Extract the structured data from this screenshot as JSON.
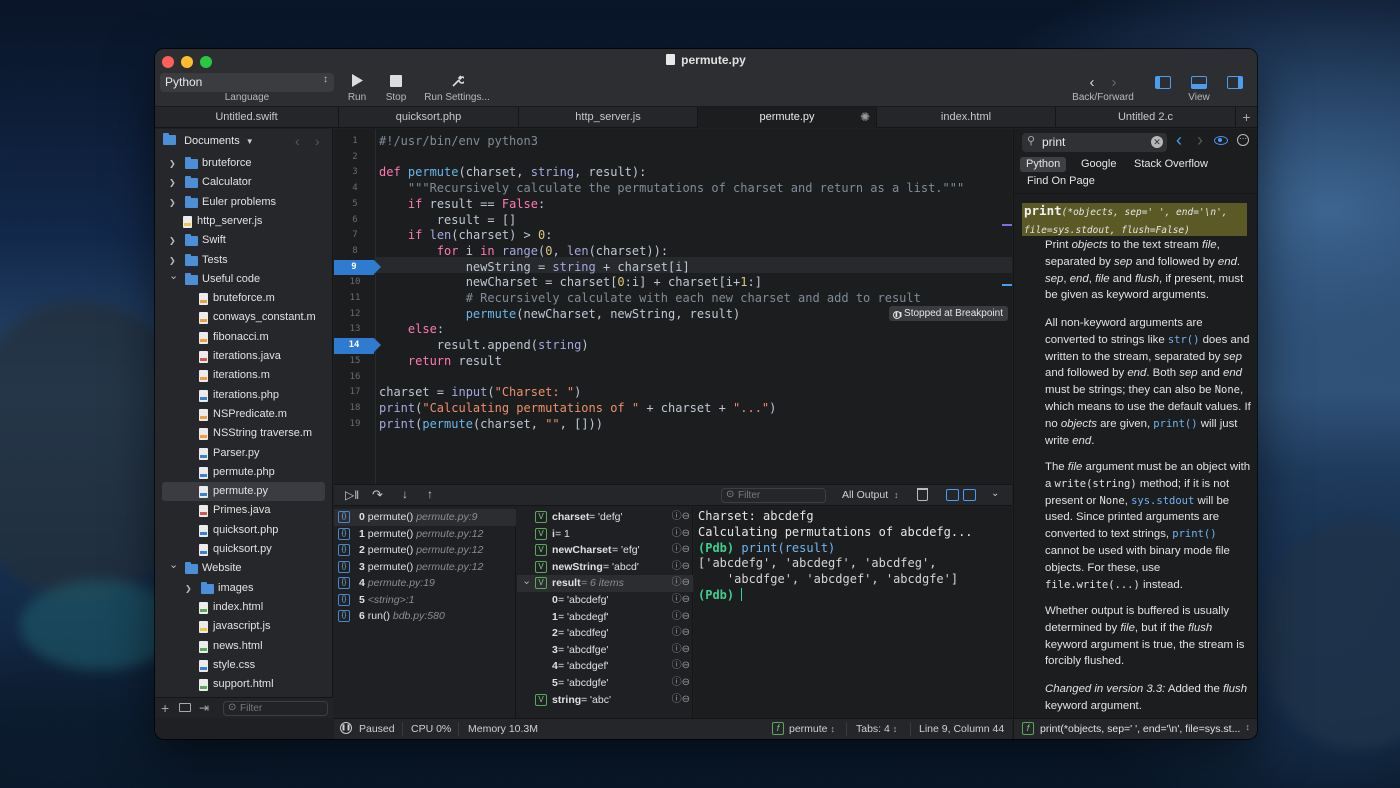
{
  "window": {
    "title": "permute.py"
  },
  "toolbar": {
    "language_value": "Python",
    "language_label": "Language",
    "run_label": "Run",
    "stop_label": "Stop",
    "run_settings_label": "Run Settings...",
    "backforward_label": "Back/Forward",
    "view_label": "View"
  },
  "tabs": [
    "Untitled.swift",
    "quicksort.php",
    "http_server.js",
    "permute.py",
    "index.html",
    "Untitled 2.c"
  ],
  "sidebar": {
    "header": "Documents",
    "filter_placeholder": "Filter",
    "items": [
      {
        "label": "bruteforce",
        "kind": "folder",
        "depth": 0,
        "expand": "closed"
      },
      {
        "label": "Calculator",
        "kind": "folder",
        "depth": 0,
        "expand": "closed"
      },
      {
        "label": "Euler problems",
        "kind": "folder",
        "depth": 0,
        "expand": "closed"
      },
      {
        "label": "http_server.js",
        "kind": "file",
        "depth": 0,
        "color": "yellow"
      },
      {
        "label": "Swift",
        "kind": "folder",
        "depth": 0,
        "expand": "closed"
      },
      {
        "label": "Tests",
        "kind": "folder",
        "depth": 0,
        "expand": "closed"
      },
      {
        "label": "Useful code",
        "kind": "folder",
        "depth": 0,
        "expand": "open"
      },
      {
        "label": "bruteforce.m",
        "kind": "file",
        "depth": 1,
        "color": "orange"
      },
      {
        "label": "conways_constant.m",
        "kind": "file",
        "depth": 1,
        "color": "orange"
      },
      {
        "label": "fibonacci.m",
        "kind": "file",
        "depth": 1,
        "color": "orange"
      },
      {
        "label": "iterations.java",
        "kind": "file",
        "depth": 1,
        "color": "red"
      },
      {
        "label": "iterations.m",
        "kind": "file",
        "depth": 1,
        "color": "orange"
      },
      {
        "label": "iterations.php",
        "kind": "file",
        "depth": 1,
        "color": "blue"
      },
      {
        "label": "NSPredicate.m",
        "kind": "file",
        "depth": 1,
        "color": "orange"
      },
      {
        "label": "NSString traverse.m",
        "kind": "file",
        "depth": 1,
        "color": "orange"
      },
      {
        "label": "Parser.py",
        "kind": "file",
        "depth": 1,
        "color": "blue"
      },
      {
        "label": "permute.php",
        "kind": "file",
        "depth": 1,
        "color": "blue"
      },
      {
        "label": "permute.py",
        "kind": "file",
        "depth": 1,
        "color": "blue",
        "selected": true
      },
      {
        "label": "Primes.java",
        "kind": "file",
        "depth": 1,
        "color": "red"
      },
      {
        "label": "quicksort.php",
        "kind": "file",
        "depth": 1,
        "color": "blue"
      },
      {
        "label": "quicksort.py",
        "kind": "file",
        "depth": 1,
        "color": "blue"
      },
      {
        "label": "Website",
        "kind": "folder",
        "depth": 0,
        "expand": "open"
      },
      {
        "label": "images",
        "kind": "folder",
        "depth": 1,
        "expand": "closed"
      },
      {
        "label": "index.html",
        "kind": "file",
        "depth": 1,
        "color": "green"
      },
      {
        "label": "javascript.js",
        "kind": "file",
        "depth": 1,
        "color": "yellow"
      },
      {
        "label": "news.html",
        "kind": "file",
        "depth": 1,
        "color": "green"
      },
      {
        "label": "style.css",
        "kind": "file",
        "depth": 1,
        "color": "blue"
      },
      {
        "label": "support.html",
        "kind": "file",
        "depth": 1,
        "color": "green"
      }
    ]
  },
  "editor": {
    "lines": [
      [
        {
          "t": "#!/usr/bin/env python3",
          "c": "cm"
        }
      ],
      [],
      [
        {
          "t": "def ",
          "c": "kw"
        },
        {
          "t": "permute",
          "c": "fn"
        },
        {
          "t": "(charset, "
        },
        {
          "t": "string",
          "c": "bi"
        },
        {
          "t": ", result):"
        }
      ],
      [
        {
          "t": "    "
        },
        {
          "t": "\"\"\"Recursively calculate the permutations of charset and return as a list.\"\"\"",
          "c": "cm"
        }
      ],
      [
        {
          "t": "    "
        },
        {
          "t": "if ",
          "c": "kw"
        },
        {
          "t": "result == "
        },
        {
          "t": "False",
          "c": "kw"
        },
        {
          "t": ":"
        }
      ],
      [
        {
          "t": "        result = []"
        }
      ],
      [
        {
          "t": "    "
        },
        {
          "t": "if ",
          "c": "kw"
        },
        {
          "t": "len",
          "c": "bi"
        },
        {
          "t": "(charset) > "
        },
        {
          "t": "0",
          "c": "nm"
        },
        {
          "t": ":"
        }
      ],
      [
        {
          "t": "        "
        },
        {
          "t": "for ",
          "c": "kw"
        },
        {
          "t": "i "
        },
        {
          "t": "in ",
          "c": "kw"
        },
        {
          "t": "range",
          "c": "bi"
        },
        {
          "t": "("
        },
        {
          "t": "0",
          "c": "nm"
        },
        {
          "t": ", "
        },
        {
          "t": "len",
          "c": "bi"
        },
        {
          "t": "(charset)):"
        }
      ],
      [
        {
          "t": "            newString = "
        },
        {
          "t": "string",
          "c": "bi"
        },
        {
          "t": " + charset[i]"
        }
      ],
      [
        {
          "t": "            newCharset = charset["
        },
        {
          "t": "0",
          "c": "nm"
        },
        {
          "t": ":i] + charset[i+"
        },
        {
          "t": "1",
          "c": "nm"
        },
        {
          "t": ":]"
        }
      ],
      [
        {
          "t": "            "
        },
        {
          "t": "# Recursively calculate with each new charset and add to result",
          "c": "cm"
        }
      ],
      [
        {
          "t": "            "
        },
        {
          "t": "permute",
          "c": "fn"
        },
        {
          "t": "(newCharset, newString, result)"
        }
      ],
      [
        {
          "t": "    "
        },
        {
          "t": "else",
          "c": "kw"
        },
        {
          "t": ":"
        }
      ],
      [
        {
          "t": "        result.append("
        },
        {
          "t": "string",
          "c": "bi"
        },
        {
          "t": ")"
        }
      ],
      [
        {
          "t": "    "
        },
        {
          "t": "return ",
          "c": "kw"
        },
        {
          "t": "result"
        }
      ],
      [],
      [
        {
          "t": "charset = "
        },
        {
          "t": "input",
          "c": "bi"
        },
        {
          "t": "("
        },
        {
          "t": "\"Charset: \"",
          "c": "str"
        },
        {
          "t": ")"
        }
      ],
      [
        {
          "t": "print",
          "c": "bi"
        },
        {
          "t": "("
        },
        {
          "t": "\"Calculating permutations of \"",
          "c": "str"
        },
        {
          "t": " + charset + "
        },
        {
          "t": "\"...\"",
          "c": "str"
        },
        {
          "t": ")"
        }
      ],
      [
        {
          "t": "print",
          "c": "bi"
        },
        {
          "t": "("
        },
        {
          "t": "permute",
          "c": "fn"
        },
        {
          "t": "(charset, "
        },
        {
          "t": "\"\"",
          "c": "str"
        },
        {
          "t": ", []))"
        }
      ]
    ],
    "breakpoints": [
      9,
      14
    ],
    "current_line": 9,
    "stopped_label": "Stopped at Breakpoint"
  },
  "debugbar": {
    "filter_placeholder": "Filter",
    "output_select": "All Output"
  },
  "stack": [
    {
      "num": "0",
      "fn": "permute()",
      "loc": "permute.py:9"
    },
    {
      "num": "1",
      "fn": "permute()",
      "loc": "permute.py:12"
    },
    {
      "num": "2",
      "fn": "permute()",
      "loc": "permute.py:12"
    },
    {
      "num": "3",
      "fn": "permute()",
      "loc": "permute.py:12"
    },
    {
      "num": "4",
      "fn": "",
      "loc": "permute.py:19"
    },
    {
      "num": "5",
      "fn": "",
      "loc": "<string>:1"
    },
    {
      "num": "6",
      "fn": "run()",
      "loc": "bdb.py:580"
    }
  ],
  "variables": [
    {
      "name": "charset",
      "value": " = 'defg'",
      "badge": "V",
      "indent": 0
    },
    {
      "name": "i",
      "value": " = 1",
      "badge": "V",
      "indent": 0
    },
    {
      "name": "newCharset",
      "value": " = 'efg'",
      "badge": "V",
      "indent": 0
    },
    {
      "name": "newString",
      "value": " = 'abcd'",
      "badge": "V",
      "indent": 0
    },
    {
      "name": "result",
      "value": " = 6 items",
      "badge": "V",
      "indent": 0,
      "expanded": true,
      "dim": true
    },
    {
      "name": "0",
      "value": " = 'abcdefg'",
      "indent": 1
    },
    {
      "name": "1",
      "value": " = 'abcdegf'",
      "indent": 1
    },
    {
      "name": "2",
      "value": " = 'abcdfeg'",
      "indent": 1
    },
    {
      "name": "3",
      "value": " = 'abcdfge'",
      "indent": 1
    },
    {
      "name": "4",
      "value": " = 'abcdgef'",
      "indent": 1
    },
    {
      "name": "5",
      "value": " = 'abcdgfe'",
      "indent": 1
    },
    {
      "name": "string",
      "value": " = 'abc'",
      "badge": "V",
      "indent": 0
    }
  ],
  "console": {
    "lines": [
      {
        "text": "Charset: abcdefg",
        "style": "out"
      },
      {
        "text": "Calculating permutations of abcdefg...",
        "style": "out"
      },
      {
        "prompt": "(Pdb) ",
        "text": "print(result)",
        "style": "cmd"
      },
      {
        "text": "['abcdefg', 'abcdegf', 'abcdfeg',",
        "style": "res"
      },
      {
        "text": "    'abcdfge', 'abcdgef', 'abcdgfe']",
        "style": "res"
      },
      {
        "prompt": "(Pdb) ",
        "text": "",
        "style": "prompt"
      }
    ]
  },
  "status": {
    "paused": "Paused",
    "cpu": "CPU 0%",
    "memory": "Memory 10.3M",
    "function": "permute",
    "tabs": "Tabs: 4",
    "position": "Line 9, Column 44"
  },
  "docs": {
    "search_value": "print",
    "tabs": [
      "Python",
      "Google",
      "Stack Overflow",
      "Find On Page"
    ],
    "signature_name": "print",
    "signature_args1": "(*objects, sep=' ', end='\\n',",
    "signature_args2": "file=sys.stdout, flush=False)",
    "footer": "print(*objects, sep=' ', end='\\n', file=sys.st..."
  }
}
